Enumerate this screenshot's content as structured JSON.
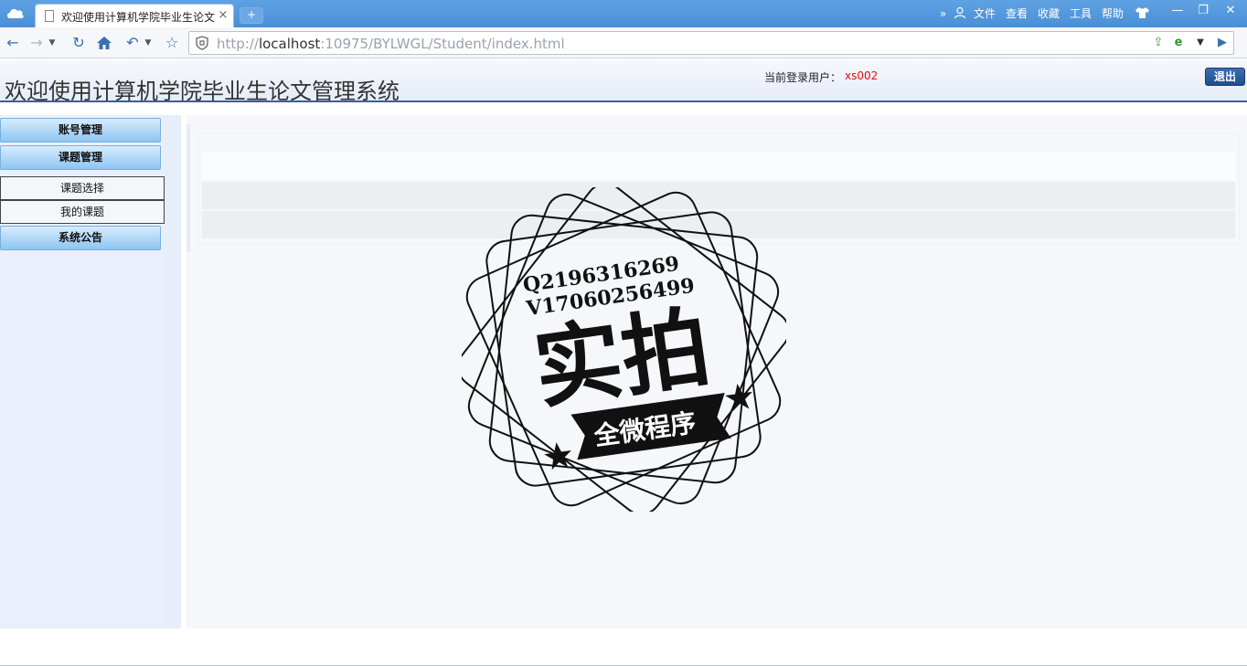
{
  "browser": {
    "tab_title": "欢迎使用计算机学院毕业生论文管理系统",
    "tab_close": "×",
    "new_tab": "+",
    "menu": [
      "文件",
      "查看",
      "收藏",
      "工具",
      "帮助"
    ],
    "overflow": "»",
    "url_prefix": "http://",
    "url_host": "localhost",
    "url_rest": ":10975/BYLWGL/Student/index.html",
    "window_controls": [
      "—",
      "❐",
      "✕"
    ]
  },
  "header": {
    "title": "欢迎使用计算机学院毕业生论文管理系统",
    "user_label": "当前登录用户：",
    "user_name": "xs002",
    "logout_label": "退出"
  },
  "sidebar": {
    "account_mgmt": "账号管理",
    "topic_mgmt": "课题管理",
    "topic_select": "课题选择",
    "my_topics": "我的课题",
    "announcements": "系统公告"
  },
  "watermark": {
    "line1": "Q2196316269",
    "line2": "V17060256499",
    "main_text": "实拍",
    "banner_text": "全微程序"
  }
}
